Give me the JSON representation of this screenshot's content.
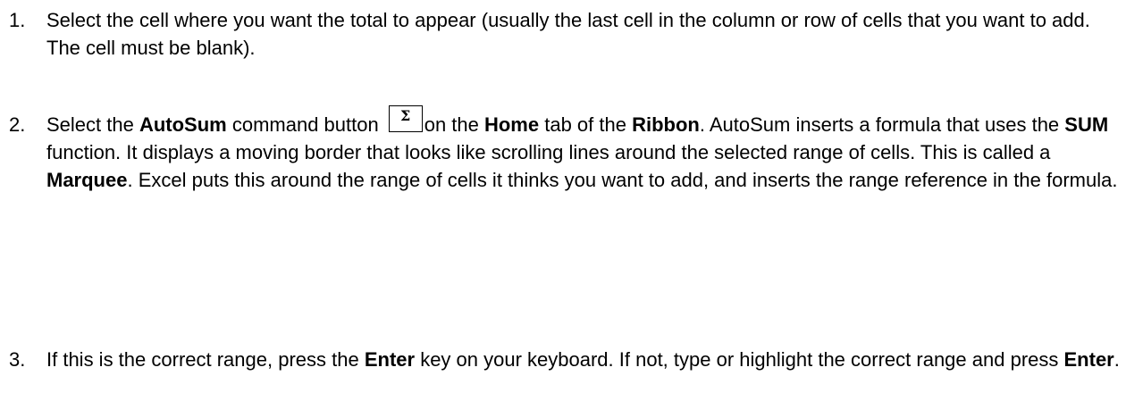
{
  "steps": [
    {
      "number": "1.",
      "segments": [
        {
          "t": "Select the cell where you want the total to appear (usually the last cell in the column or row of cells that you want to add. The cell must be blank)."
        }
      ]
    },
    {
      "number": "2.",
      "segments": [
        {
          "t": "Select the "
        },
        {
          "t": "AutoSum",
          "b": true
        },
        {
          "t": " command button"
        },
        {
          "icon": "Σ",
          "name": "autosum-sigma-icon"
        },
        {
          "t": "on the "
        },
        {
          "t": "Home",
          "b": true
        },
        {
          "t": " tab of the "
        },
        {
          "t": "Ribbon",
          "b": true
        },
        {
          "t": ". AutoSum inserts a formula that uses the "
        },
        {
          "t": "SUM",
          "b": true
        },
        {
          "t": " function. It displays a moving border that looks like scrolling lines around the selected range of cells. This is called a "
        },
        {
          "t": "Marquee",
          "b": true
        },
        {
          "t": ". Excel puts this around the range of cells it thinks you want to add, and inserts the range reference in the formula."
        }
      ]
    },
    {
      "number": "3.",
      "segments": [
        {
          "t": "If this is the correct range, press the "
        },
        {
          "t": "Enter",
          "b": true
        },
        {
          "t": " key on your keyboard. If not, type or highlight the correct range and press "
        },
        {
          "t": "Enter",
          "b": true
        },
        {
          "t": "."
        }
      ]
    }
  ]
}
